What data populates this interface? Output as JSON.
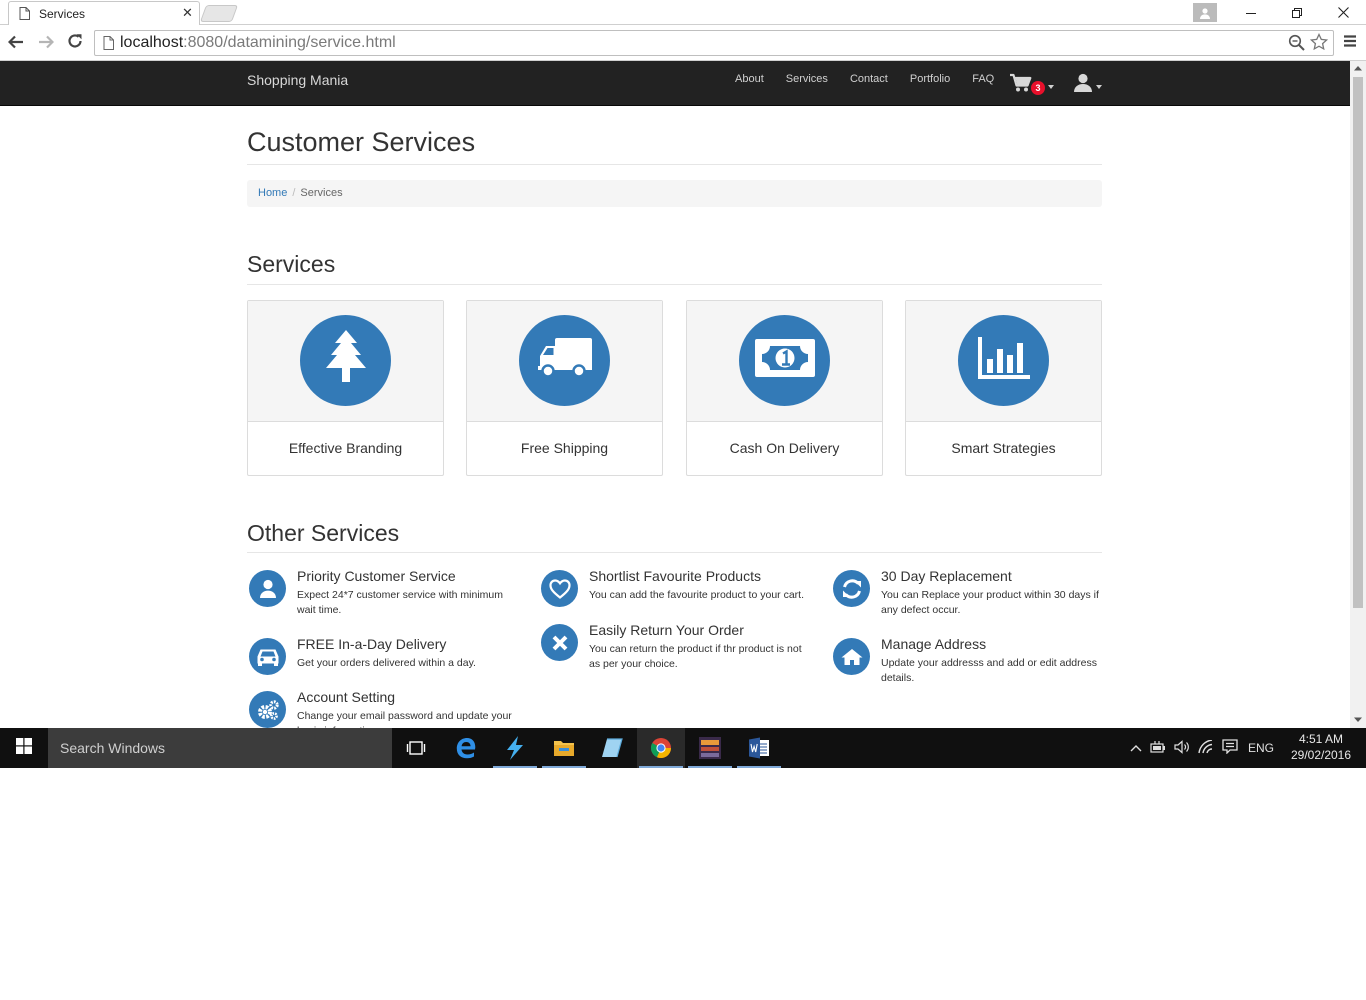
{
  "browser": {
    "tab_title": "Services",
    "tab_close": "✕",
    "url_host": "localhost",
    "url_rest": ":8080/datamining/service.html"
  },
  "site": {
    "brand": "Shopping Mania",
    "nav": [
      "About",
      "Services",
      "Contact",
      "Portfolio",
      "FAQ"
    ],
    "cart_count": "3"
  },
  "page": {
    "title": "Customer Services",
    "breadcrumb": {
      "home": "Home",
      "sep": "/",
      "current": "Services"
    }
  },
  "services": {
    "heading": "Services",
    "items": [
      {
        "label": "Effective Branding",
        "icon": "tree-icon"
      },
      {
        "label": "Free Shipping",
        "icon": "truck-icon"
      },
      {
        "label": "Cash On Delivery",
        "icon": "money-icon"
      },
      {
        "label": "Smart Strategies",
        "icon": "bar-chart-icon"
      }
    ]
  },
  "other_services": {
    "heading": "Other Services",
    "items": [
      {
        "title": "Priority Customer Service",
        "text": "Expect 24*7 customer service with minimum wait time.",
        "icon": "user-icon"
      },
      {
        "title": "Shortlist Favourite Products",
        "text": "You can add the favourite product to your cart.",
        "icon": "heart-icon"
      },
      {
        "title": "30 Day Replacement",
        "text": "You can Replace your product within 30 days if any defect occur.",
        "icon": "refresh-icon"
      },
      {
        "title": "FREE In-a-Day Delivery",
        "text": "Get your orders delivered within a day.",
        "icon": "car-icon"
      },
      {
        "title": "Easily Return Your Order",
        "text": "You can return the product if thr product is not as per your choice.",
        "icon": "times-icon"
      },
      {
        "title": "Manage Address",
        "text": "Update your addresss and add or edit address details.",
        "icon": "home-icon"
      },
      {
        "title": "Account Setting",
        "text": "Change your email password and update your basic information.",
        "icon": "cogs-icon"
      }
    ]
  },
  "taskbar": {
    "search_placeholder": "Search Windows",
    "language": "ENG",
    "time": "4:51 AM",
    "date": "29/02/2016"
  },
  "colors": {
    "accent": "#337ab7",
    "navbar": "#222222",
    "badge": "#e8102b"
  }
}
